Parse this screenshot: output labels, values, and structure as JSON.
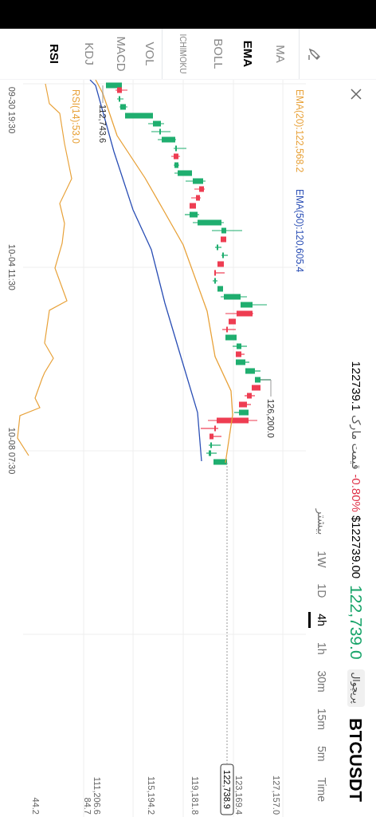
{
  "header": {
    "symbol": "BTCUSDT",
    "tag": "پرپچوال",
    "last_price": "122,739.0",
    "usd_price": "$122739.00",
    "change": "-0.80%",
    "mark_label": "قیمت مارک",
    "mark_price": "122739.1"
  },
  "timeframes": [
    {
      "label": "بیشتر",
      "selected": false
    },
    {
      "label": "1W",
      "selected": false
    },
    {
      "label": "1D",
      "selected": false
    },
    {
      "label": "4h",
      "selected": true
    },
    {
      "label": "1h",
      "selected": false
    },
    {
      "label": "30m",
      "selected": false
    },
    {
      "label": "15m",
      "selected": false
    },
    {
      "label": "5m",
      "selected": false
    },
    {
      "label": "Time",
      "selected": false
    }
  ],
  "indicators": [
    {
      "label": "MA",
      "selected": false
    },
    {
      "label": "EMA",
      "selected": true
    },
    {
      "label": "BOLL",
      "selected": false
    },
    {
      "label": "ICHIMOKU",
      "selected": false
    },
    {
      "label": "VOL",
      "selected": false
    },
    {
      "label": "MACD",
      "selected": false
    },
    {
      "label": "KDJ",
      "selected": false
    },
    {
      "label": "RSI",
      "selected": true
    }
  ],
  "chart": {
    "legend": [
      {
        "label": "EMA(20):122,568.2",
        "color": "#e8a23a"
      },
      {
        "label": "EMA(50):120,605.4",
        "color": "#2b4fb5"
      }
    ],
    "price_axis": [
      "127,157.0",
      "123,169.4",
      "119,181.8",
      "115,194.2",
      "111,206.6"
    ],
    "current_price": "122,738.9",
    "high_label": "126,200.0",
    "low_label": "112,743.6",
    "rsi_label": "RSI(14):53.0",
    "rsi_axis": [
      "84.7",
      "44.2"
    ],
    "time_axis": [
      "09-30 19:30",
      "10-04 11:30",
      "10-08 07:30"
    ]
  }
}
